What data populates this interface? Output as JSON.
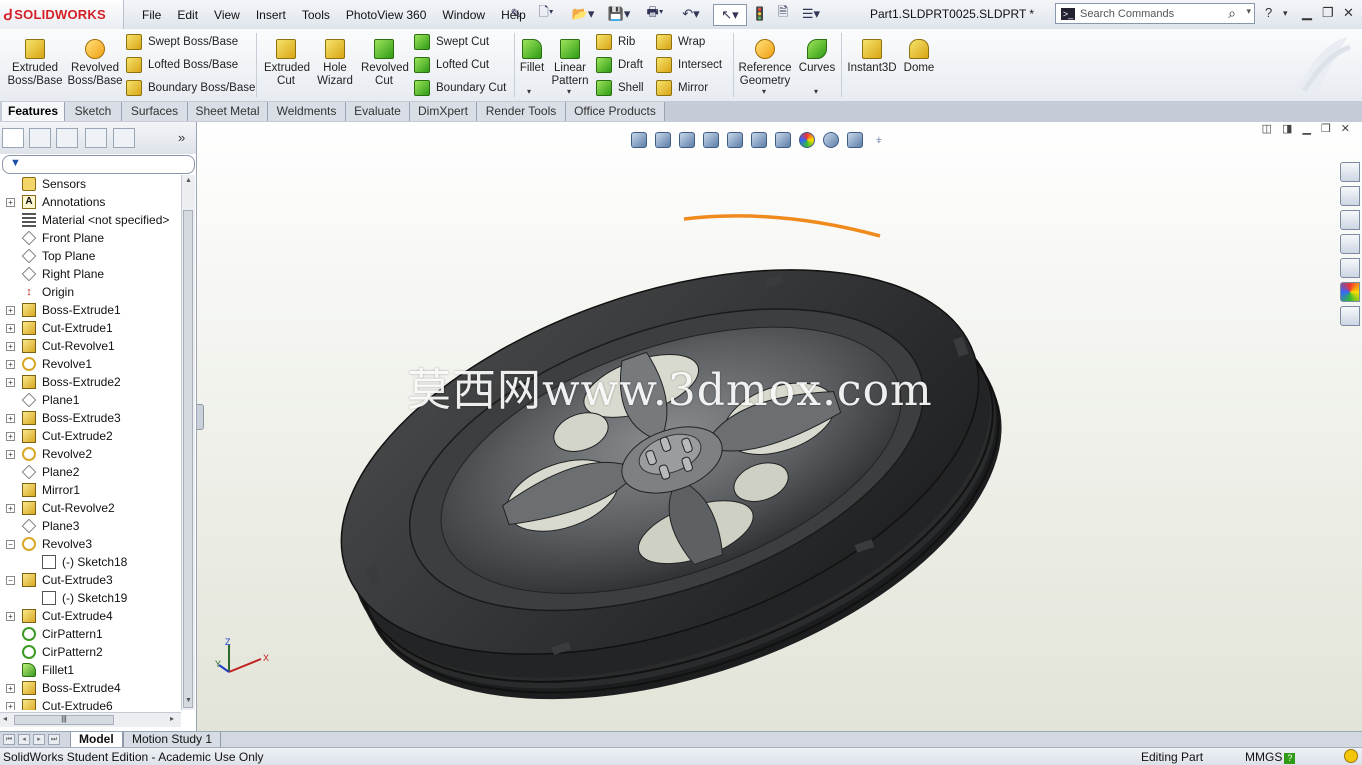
{
  "app": {
    "brand": "SOLIDWORKS",
    "file_title": "Part1.SLDPRT0025.SLDPRT *",
    "menu": [
      "File",
      "Edit",
      "View",
      "Insert",
      "Tools",
      "PhotoView 360",
      "Window",
      "Help"
    ]
  },
  "search": {
    "placeholder": "Search Commands"
  },
  "commands": {
    "extruded_boss": "Extruded Boss/Base",
    "revolved_boss": "Revolved Boss/Base",
    "swept_boss": "Swept Boss/Base",
    "lofted_boss": "Lofted Boss/Base",
    "boundary_boss": "Boundary Boss/Base",
    "extruded_cut": "Extruded Cut",
    "hole_wizard": "Hole Wizard",
    "revolved_cut": "Revolved Cut",
    "swept_cut": "Swept Cut",
    "lofted_cut": "Lofted Cut",
    "boundary_cut": "Boundary Cut",
    "fillet": "Fillet",
    "linear_pattern": "Linear Pattern",
    "rib": "Rib",
    "draft": "Draft",
    "shell": "Shell",
    "wrap": "Wrap",
    "intersect": "Intersect",
    "mirror": "Mirror",
    "reference_geometry": "Reference Geometry",
    "curves": "Curves",
    "instant3d": "Instant3D",
    "dome": "Dome"
  },
  "tabs": [
    "Features",
    "Sketch",
    "Surfaces",
    "Sheet Metal",
    "Weldments",
    "Evaluate",
    "DimXpert",
    "Render Tools",
    "Office Products"
  ],
  "tree": [
    {
      "label": "Sensors",
      "icon": "sensor-icon",
      "expand": false
    },
    {
      "label": "Annotations",
      "icon": "annotation-icon",
      "expand": true
    },
    {
      "label": "Material <not specified>",
      "icon": "material-icon",
      "expand": false
    },
    {
      "label": "Front Plane",
      "icon": "plane-icon",
      "expand": false
    },
    {
      "label": "Top Plane",
      "icon": "plane-icon",
      "expand": false
    },
    {
      "label": "Right Plane",
      "icon": "plane-icon",
      "expand": false
    },
    {
      "label": "Origin",
      "icon": "origin-icon",
      "expand": false
    },
    {
      "label": "Boss-Extrude1",
      "icon": "extrude-icon",
      "expand": true
    },
    {
      "label": "Cut-Extrude1",
      "icon": "extrude-icon",
      "expand": true
    },
    {
      "label": "Cut-Revolve1",
      "icon": "revolve-cut-icon",
      "expand": true
    },
    {
      "label": "Revolve1",
      "icon": "revolve-icon",
      "expand": true
    },
    {
      "label": "Boss-Extrude2",
      "icon": "extrude-icon",
      "expand": true
    },
    {
      "label": "Plane1",
      "icon": "plane-icon",
      "expand": false
    },
    {
      "label": "Boss-Extrude3",
      "icon": "extrude-icon",
      "expand": true
    },
    {
      "label": "Cut-Extrude2",
      "icon": "extrude-icon",
      "expand": true
    },
    {
      "label": "Revolve2",
      "icon": "revolve-icon",
      "expand": true
    },
    {
      "label": "Plane2",
      "icon": "plane-icon",
      "expand": false
    },
    {
      "label": "Mirror1",
      "icon": "mirror-icon",
      "expand": false
    },
    {
      "label": "Cut-Revolve2",
      "icon": "revolve-cut-icon",
      "expand": true
    },
    {
      "label": "Plane3",
      "icon": "plane-icon",
      "expand": false
    },
    {
      "label": "Revolve3",
      "icon": "revolve-icon",
      "expand": "open"
    },
    {
      "label": "(-) Sketch18",
      "icon": "sketch-icon",
      "child": true
    },
    {
      "label": "Cut-Extrude3",
      "icon": "extrude-icon",
      "expand": "open"
    },
    {
      "label": "(-) Sketch19",
      "icon": "sketch-icon",
      "child": true
    },
    {
      "label": "Cut-Extrude4",
      "icon": "extrude-icon",
      "expand": true
    },
    {
      "label": "CirPattern1",
      "icon": "pattern-icon",
      "expand": false
    },
    {
      "label": "CirPattern2",
      "icon": "pattern-icon",
      "expand": false
    },
    {
      "label": "Fillet1",
      "icon": "fillet-icon",
      "expand": false
    },
    {
      "label": "Boss-Extrude4",
      "icon": "extrude-icon",
      "expand": true
    },
    {
      "label": "Cut-Extrude6",
      "icon": "extrude-icon",
      "expand": true
    }
  ],
  "viewport": {
    "watermark": "莫西网www.3dmox.com",
    "triad_axes": {
      "x": "X",
      "y": "Y",
      "z": "Z"
    }
  },
  "bottom_tabs": [
    "Model",
    "Motion Study 1"
  ],
  "status": {
    "edition": "SolidWorks Student Edition - Academic Use Only",
    "mode": "Editing Part",
    "units": "MMGS"
  },
  "colors": {
    "brand_red": "#d41f26",
    "selection_orange": "#f08a1c",
    "feature_yellow": "#e1b22a"
  }
}
